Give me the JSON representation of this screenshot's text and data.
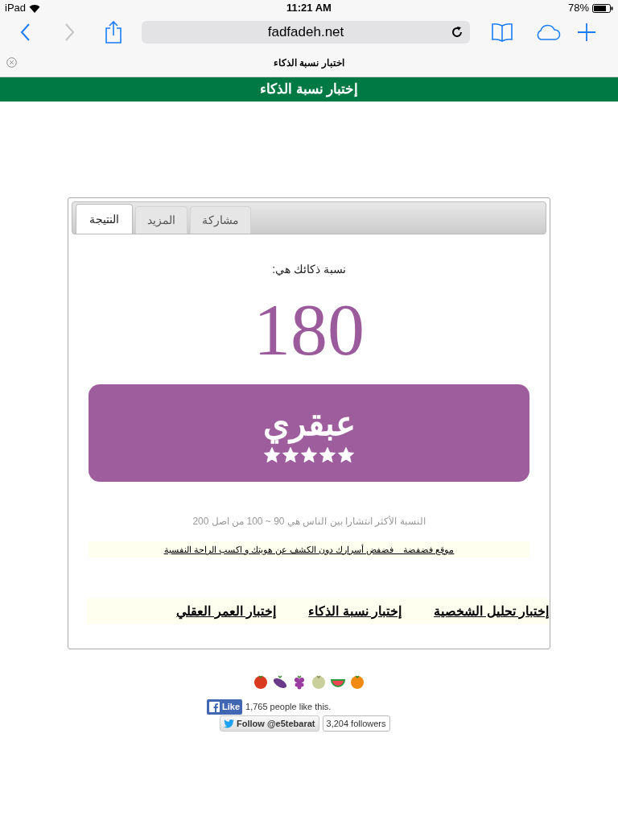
{
  "status_bar": {
    "device": "iPad",
    "time": "11:21 AM",
    "battery": "78%"
  },
  "browser": {
    "url": "fadfadeh.net",
    "tab_title": "اختبار نسبة الذكاء"
  },
  "banner": {
    "title": "إختبار نسبة الذكاء"
  },
  "tabs": [
    {
      "label": "مشاركة",
      "selected": false
    },
    {
      "label": "المزيد",
      "selected": false
    },
    {
      "label": "النتيجة",
      "selected": true
    }
  ],
  "result": {
    "intro": "نسبة ذكائك هي:",
    "score": "180",
    "verdict": "عبقري",
    "stars": 5
  },
  "note": "النسبة الأكثر انتشارا بين الناس هي 90 ~ 100 من اصل 200",
  "site_link": "موقع فضفضة _ فضفض أسرارك دون الكشف عن هويتك و اكسب الراحة النفسية",
  "test_links": [
    "إختبار تحليل الشخصية",
    "إختبار نسبة الذكاء",
    "إختبار العمر العقلي"
  ],
  "social": {
    "like_button": "Like",
    "like_count": "1,765 people like this.",
    "follow_button": "Follow @e5tebarat",
    "followers": "3,204 followers"
  }
}
